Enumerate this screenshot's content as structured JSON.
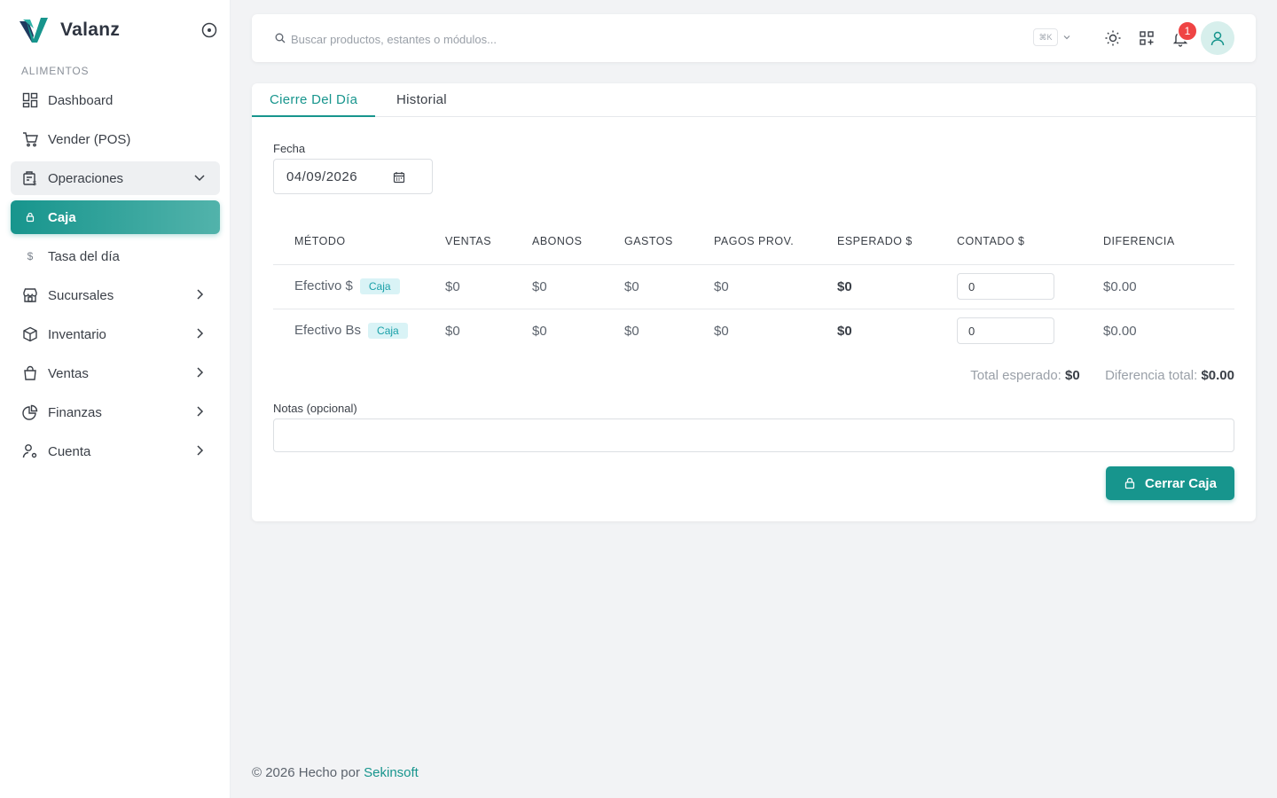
{
  "brand": {
    "name": "Valanz"
  },
  "sidebar": {
    "section": "ALIMENTOS",
    "items": [
      {
        "label": "Dashboard",
        "icon": "dashboard-icon"
      },
      {
        "label": "Vender (POS)",
        "icon": "cart-icon"
      },
      {
        "label": "Operaciones",
        "icon": "operations-icon",
        "state": "open"
      },
      {
        "label": "Caja",
        "icon": "lock-icon",
        "state": "active"
      },
      {
        "label": "Tasa del día",
        "icon": "dollar-icon"
      },
      {
        "label": "Sucursales",
        "icon": "store-icon"
      },
      {
        "label": "Inventario",
        "icon": "box-icon"
      },
      {
        "label": "Ventas",
        "icon": "bag-icon"
      },
      {
        "label": "Finanzas",
        "icon": "pie-chart-icon"
      },
      {
        "label": "Cuenta",
        "icon": "user-gear-icon"
      }
    ]
  },
  "header": {
    "search_placeholder": "Buscar productos, estantes o módulos...",
    "shortcut": "⌘K",
    "notifications_count": "1"
  },
  "tabs": [
    "Cierre Del Día",
    "Historial"
  ],
  "form": {
    "date_label": "Fecha",
    "date_value": "04/09/2026",
    "notes_label": "Notas (opcional)",
    "notes_value": ""
  },
  "table": {
    "headers": [
      "MÉTODO",
      "VENTAS",
      "ABONOS",
      "GASTOS",
      "PAGOS PROV.",
      "ESPERADO $",
      "CONTADO $",
      "DIFERENCIA"
    ],
    "rows": [
      {
        "method": "Efectivo $",
        "tag": "Caja",
        "ventas": "$0",
        "abonos": "$0",
        "gastos": "$0",
        "pagos": "$0",
        "esperado": "$0",
        "contado": "0",
        "diferencia": "$0.00"
      },
      {
        "method": "Efectivo Bs",
        "tag": "Caja",
        "ventas": "$0",
        "abonos": "$0",
        "gastos": "$0",
        "pagos": "$0",
        "esperado": "$0",
        "contado": "0",
        "diferencia": "$0.00"
      }
    ]
  },
  "totals": {
    "expected_label": "Total esperado:",
    "expected_value": "$0",
    "diff_label": "Diferencia total:",
    "diff_value": "$0.00"
  },
  "actions": {
    "close_label": "Cerrar Caja"
  },
  "footer": {
    "text": "© 2026 Hecho por",
    "link": "Sekinsoft"
  },
  "colors": {
    "accent": "#17958d",
    "badge": "#ef4444",
    "tag_bg": "#d9f3f6"
  }
}
